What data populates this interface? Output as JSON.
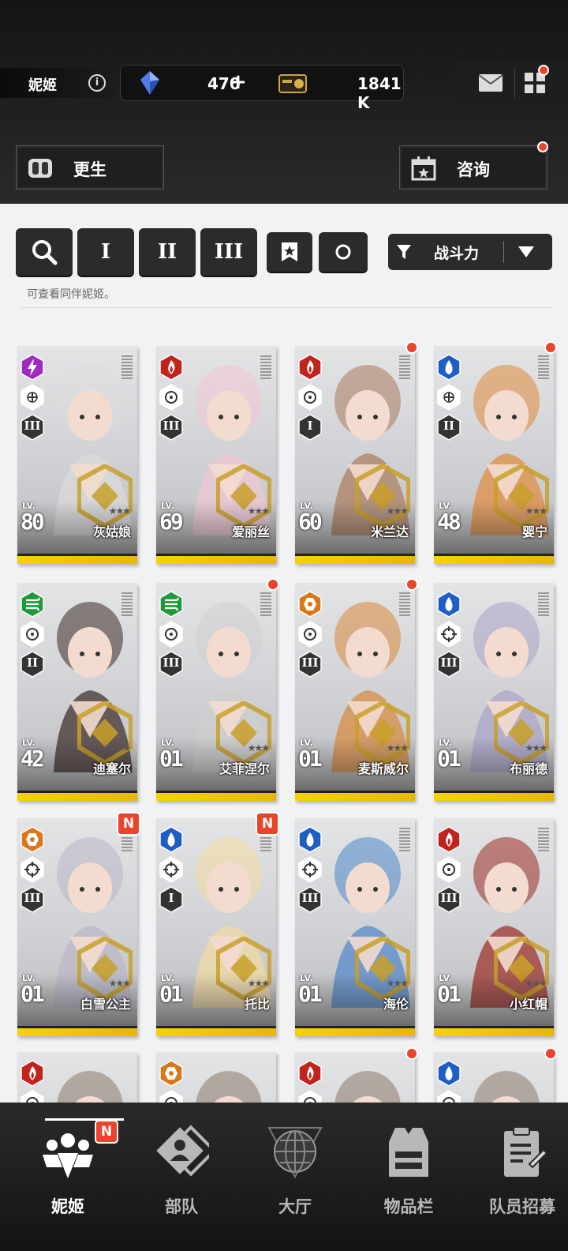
{
  "header": {
    "name": "妮姬",
    "gems": "470",
    "gems_add": "+",
    "credits": "1841 K",
    "rebirth_label": "更生",
    "consult_label": "咨询"
  },
  "filters": {
    "burst_1": "I",
    "burst_2": "II",
    "burst_3": "III",
    "sort_label": "战斗力",
    "hint": "可查看同伴妮姬。"
  },
  "colors": {
    "fire": "#c0241c",
    "electric": "#9e2bbf",
    "wind": "#1f9a3b",
    "water": "#1f5fc4",
    "iron": "#d9781a",
    "gold": "#f5d300",
    "badge_red": "#e9442c"
  },
  "cards": [
    {
      "name": "灰姑娘",
      "lv_tag": "LV.",
      "level": "80",
      "element": "electric",
      "weapon": "sniper-icon",
      "burst": "III",
      "dot": false,
      "badge": ""
    },
    {
      "name": "爱丽丝",
      "lv_tag": "LV.",
      "level": "69",
      "element": "fire",
      "weapon": "target-icon",
      "burst": "III",
      "dot": false,
      "badge": ""
    },
    {
      "name": "米兰达",
      "lv_tag": "LV.",
      "level": "60",
      "element": "fire",
      "weapon": "target-icon",
      "burst": "I",
      "dot": true,
      "badge": ""
    },
    {
      "name": "婴宁",
      "lv_tag": "LV.",
      "level": "48",
      "element": "water",
      "weapon": "sniper-icon",
      "burst": "II",
      "dot": true,
      "badge": ""
    },
    {
      "name": "迪塞尔",
      "lv_tag": "LV.",
      "level": "42",
      "element": "wind",
      "weapon": "target-icon",
      "burst": "II",
      "dot": false,
      "badge": ""
    },
    {
      "name": "艾菲涅尔",
      "lv_tag": "LV.",
      "level": "01",
      "element": "wind",
      "weapon": "target-icon",
      "burst": "III",
      "dot": true,
      "badge": ""
    },
    {
      "name": "麦斯威尔",
      "lv_tag": "LV.",
      "level": "01",
      "element": "iron",
      "weapon": "target-icon",
      "burst": "III",
      "dot": true,
      "badge": ""
    },
    {
      "name": "布丽德",
      "lv_tag": "LV.",
      "level": "01",
      "element": "water",
      "weapon": "crosshair-icon",
      "burst": "III",
      "dot": false,
      "badge": ""
    },
    {
      "name": "白雪公主",
      "lv_tag": "LV.",
      "level": "01",
      "element": "iron",
      "weapon": "crosshair-icon",
      "burst": "III",
      "dot": false,
      "badge": "N"
    },
    {
      "name": "托比",
      "lv_tag": "LV.",
      "level": "01",
      "element": "water",
      "weapon": "crosshair-icon",
      "burst": "I",
      "dot": false,
      "badge": "N"
    },
    {
      "name": "海伦",
      "lv_tag": "LV.",
      "level": "01",
      "element": "water",
      "weapon": "crosshair-icon",
      "burst": "III",
      "dot": false,
      "badge": ""
    },
    {
      "name": "小红帽",
      "lv_tag": "LV.",
      "level": "01",
      "element": "fire",
      "weapon": "target-icon",
      "burst": "III",
      "dot": false,
      "badge": ""
    }
  ],
  "partial_cards": [
    {
      "element": "fire",
      "dot": false
    },
    {
      "element": "iron",
      "dot": false
    },
    {
      "element": "fire",
      "dot": true
    },
    {
      "element": "water",
      "dot": true
    }
  ],
  "nav": [
    {
      "label": "妮姬",
      "badge": "N",
      "active": true
    },
    {
      "label": "部队"
    },
    {
      "label": "大厅"
    },
    {
      "label": "物品栏"
    },
    {
      "label": "队员招募"
    }
  ]
}
